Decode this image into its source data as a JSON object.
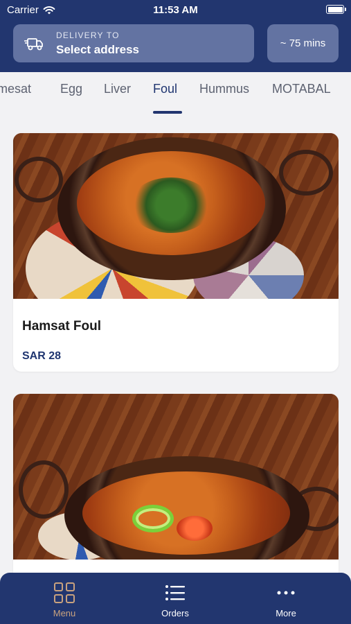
{
  "status_bar": {
    "carrier": "Carrier",
    "time": "11:53 AM"
  },
  "delivery": {
    "label": "DELIVERY TO",
    "value": "Select address"
  },
  "eta": "~ 75 mins",
  "tabs": [
    {
      "label": "mesat"
    },
    {
      "label": "Egg"
    },
    {
      "label": "Liver"
    },
    {
      "label": "Foul"
    },
    {
      "label": "Hummus"
    },
    {
      "label": "MOTABAL"
    }
  ],
  "active_tab": "Foul",
  "items": [
    {
      "name": "Hamsat Foul",
      "price": "SAR 28"
    },
    {
      "name": "",
      "price": ""
    }
  ],
  "bottom_nav": [
    {
      "label": "Menu",
      "icon": "grid-icon",
      "active": true
    },
    {
      "label": "Orders",
      "icon": "list-icon",
      "active": false
    },
    {
      "label": "More",
      "icon": "more-dots-icon",
      "active": false
    }
  ],
  "colors": {
    "header": "#22366f",
    "header_button": "#6373a2",
    "active_tab": "#1f3570",
    "nav_active": "#c9a27e",
    "background": "#f2f2f4"
  }
}
